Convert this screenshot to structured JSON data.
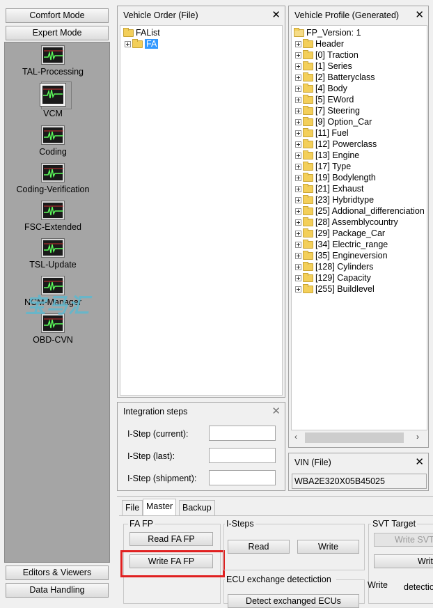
{
  "modes": {
    "comfort": "Comfort Mode",
    "expert": "Expert Mode",
    "editors": "Editors & Viewers",
    "data_handling": "Data Handling"
  },
  "tools": [
    {
      "label": "TAL-Processing",
      "icon": "ecg-monitor-icon"
    },
    {
      "label": "VCM",
      "icon": "ecg-monitor-icon",
      "selected": true
    },
    {
      "label": "Coding",
      "icon": "ecg-monitor-icon"
    },
    {
      "label": "Coding-Verification",
      "icon": "ecg-monitor-icon"
    },
    {
      "label": "FSC-Extended",
      "icon": "ecg-monitor-icon"
    },
    {
      "label": "TSL-Update",
      "icon": "ecg-monitor-icon"
    },
    {
      "label": "NCM-Manager",
      "icon": "ecg-monitor-icon"
    },
    {
      "label": "OBD-CVN",
      "icon": "ecg-monitor-icon"
    }
  ],
  "watermark": "宝马汇",
  "vehicle_order": {
    "title": "Vehicle Order (File)",
    "root": "FAList",
    "child": "FA"
  },
  "vehicle_profile": {
    "title": "Vehicle Profile (Generated)",
    "root": "FP_Version: 1",
    "items": [
      "Header",
      "[0] Traction",
      "[1] Series",
      "[2] Batteryclass",
      "[4] Body",
      "[5] EWord",
      "[7] Steering",
      "[9] Option_Car",
      "[11] Fuel",
      "[12] Powerclass",
      "[13] Engine",
      "[17] Type",
      "[19] Bodylength",
      "[21] Exhaust",
      "[23] Hybridtype",
      "[25] Addional_differenciation",
      "[28] Assemblycountry",
      "[29] Package_Car",
      "[34] Electric_range",
      "[35] Engineversion",
      "[128] Cylinders",
      "[129] Capacity",
      "[255] Buildlevel"
    ]
  },
  "integration_steps": {
    "title": "Integration steps",
    "current_label": "I-Step (current):",
    "last_label": "I-Step (last):",
    "shipment_label": "I-Step (shipment):",
    "current_value": "",
    "last_value": "",
    "shipment_value": ""
  },
  "vin": {
    "title": "VIN (File)",
    "value": "WBA2E320X05B45025"
  },
  "tabs": [
    "File",
    "Master",
    "Backup"
  ],
  "fa_fp": {
    "label": "FA FP",
    "read": "Read FA FP",
    "write": "Write FA FP"
  },
  "i_steps": {
    "label": "I-Steps",
    "read": "Read",
    "write": "Write"
  },
  "ecu_exchange": {
    "label": "ECU exchange detectiction",
    "detect": "Detect exchanged ECUs"
  },
  "svt_target": {
    "label": "SVT Target",
    "write_svt": "Write SVT",
    "write_svt2": "Write SVT",
    "write": "Write",
    "detection": "detection"
  },
  "close_glyph": "✕"
}
